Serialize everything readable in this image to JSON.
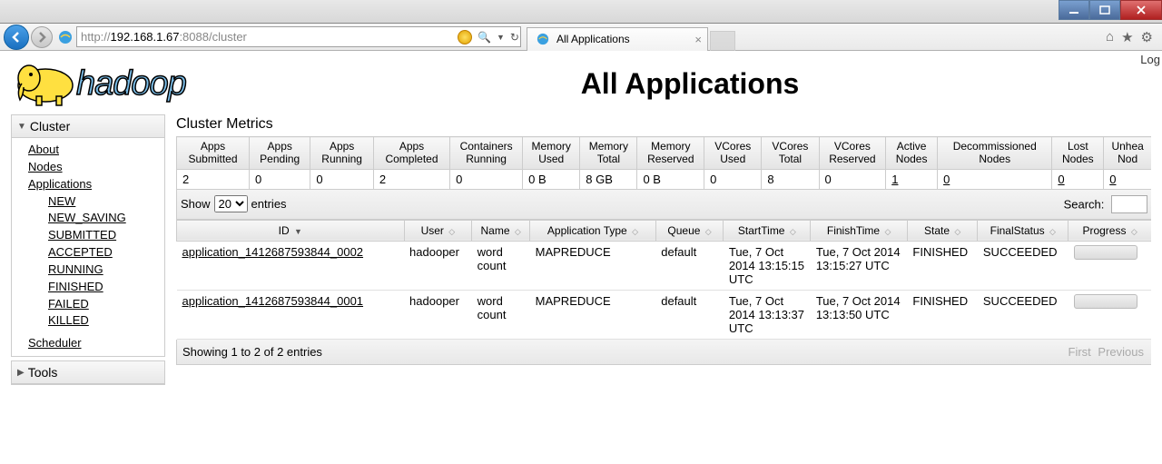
{
  "browser": {
    "url_proto": "http://",
    "url_host": "192.168.1.67",
    "url_port": ":8088",
    "url_path": "/cluster",
    "tab_title": "All Applications"
  },
  "page": {
    "logo_text": "hadoop",
    "title": "All Applications",
    "login_text": "Log"
  },
  "sidebar": {
    "cluster_head": "Cluster",
    "about": "About",
    "nodes": "Nodes",
    "applications": "Applications",
    "states": [
      "NEW",
      "NEW_SAVING",
      "SUBMITTED",
      "ACCEPTED",
      "RUNNING",
      "FINISHED",
      "FAILED",
      "KILLED"
    ],
    "scheduler": "Scheduler",
    "tools_head": "Tools"
  },
  "metrics": {
    "title": "Cluster Metrics",
    "headers": [
      "Apps Submitted",
      "Apps Pending",
      "Apps Running",
      "Apps Completed",
      "Containers Running",
      "Memory Used",
      "Memory Total",
      "Memory Reserved",
      "VCores Used",
      "VCores Total",
      "VCores Reserved",
      "Active Nodes",
      "Decommissioned Nodes",
      "Lost Nodes",
      "Unhea Nod"
    ],
    "values": [
      "2",
      "0",
      "0",
      "2",
      "0",
      "0 B",
      "8 GB",
      "0 B",
      "0",
      "8",
      "0",
      "1",
      "0",
      "0",
      "0"
    ],
    "links": [
      false,
      false,
      false,
      false,
      false,
      false,
      false,
      false,
      false,
      false,
      false,
      true,
      true,
      true,
      true
    ]
  },
  "list_controls": {
    "show_prefix": "Show",
    "show_value": "20",
    "show_suffix": "entries",
    "search_label": "Search:"
  },
  "apps": {
    "headers": [
      "ID",
      "User",
      "Name",
      "Application Type",
      "Queue",
      "StartTime",
      "FinishTime",
      "State",
      "FinalStatus",
      "Progress"
    ],
    "rows": [
      {
        "id": "application_1412687593844_0002",
        "user": "hadooper",
        "name": "word count",
        "type": "MAPREDUCE",
        "queue": "default",
        "start": "Tue, 7 Oct 2014 13:15:15 UTC",
        "finish": "Tue, 7 Oct 2014 13:15:27 UTC",
        "state": "FINISHED",
        "final": "SUCCEEDED"
      },
      {
        "id": "application_1412687593844_0001",
        "user": "hadooper",
        "name": "word count",
        "type": "MAPREDUCE",
        "queue": "default",
        "start": "Tue, 7 Oct 2014 13:13:37 UTC",
        "finish": "Tue, 7 Oct 2014 13:13:50 UTC",
        "state": "FINISHED",
        "final": "SUCCEEDED"
      }
    ]
  },
  "footer": {
    "showing": "Showing 1 to 2 of 2 entries",
    "first": "First",
    "previous": "Previous"
  }
}
